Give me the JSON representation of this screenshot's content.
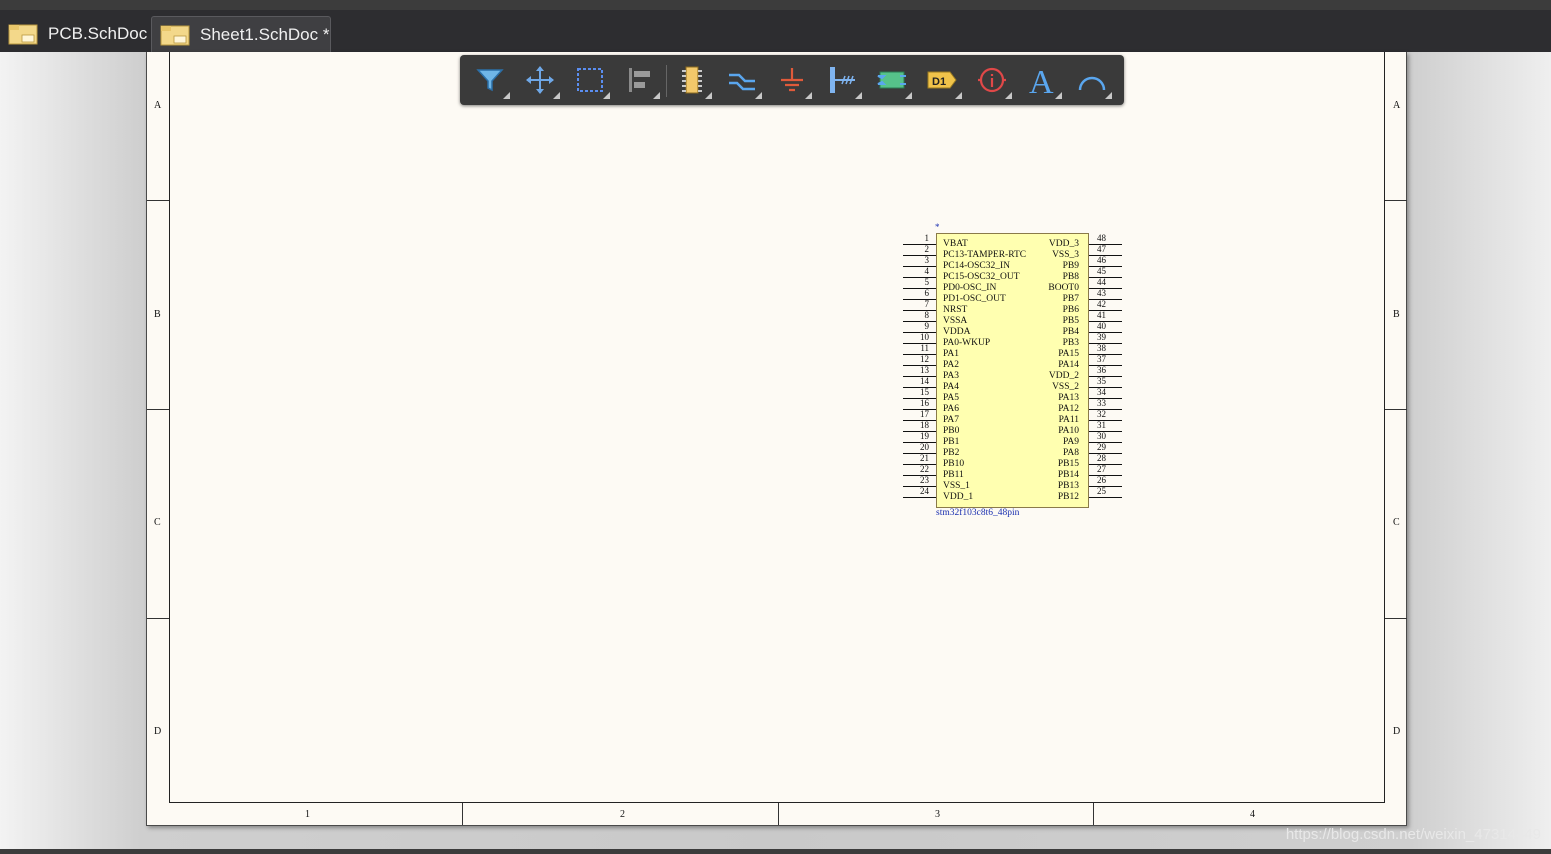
{
  "tabs": [
    {
      "label": "PCB.SchDoc",
      "active": false
    },
    {
      "label": "Sheet1.SchDoc *",
      "active": true
    }
  ],
  "toolbar": {
    "tools": [
      {
        "icon": "filter-icon"
      },
      {
        "icon": "move-icon"
      },
      {
        "icon": "select-rect-icon"
      },
      {
        "icon": "align-icon"
      },
      {
        "icon": "place-component-icon"
      },
      {
        "icon": "wire-icon"
      },
      {
        "icon": "power-port-icon"
      },
      {
        "icon": "harness-icon"
      },
      {
        "icon": "sheet-symbol-icon"
      },
      {
        "icon": "port-icon",
        "text": "D1"
      },
      {
        "icon": "directive-icon"
      },
      {
        "icon": "text-icon",
        "text": "A"
      },
      {
        "icon": "arc-icon"
      }
    ]
  },
  "sheet": {
    "row_letters": [
      "A",
      "B",
      "C",
      "D"
    ],
    "col_numbers": [
      "1",
      "2",
      "3",
      "4"
    ]
  },
  "component": {
    "designator": "*",
    "name": "stm32f103c8t6_48pin",
    "left_pins": [
      {
        "num": "1",
        "name": "VBAT"
      },
      {
        "num": "2",
        "name": "PC13-TAMPER-RTC"
      },
      {
        "num": "3",
        "name": "PC14-OSC32_IN"
      },
      {
        "num": "4",
        "name": "PC15-OSC32_OUT"
      },
      {
        "num": "5",
        "name": "PD0-OSC_IN"
      },
      {
        "num": "6",
        "name": "PD1-OSC_OUT"
      },
      {
        "num": "7",
        "name": "NRST"
      },
      {
        "num": "8",
        "name": "VSSA"
      },
      {
        "num": "9",
        "name": "VDDA"
      },
      {
        "num": "10",
        "name": "PA0-WKUP"
      },
      {
        "num": "11",
        "name": "PA1"
      },
      {
        "num": "12",
        "name": "PA2"
      },
      {
        "num": "13",
        "name": "PA3"
      },
      {
        "num": "14",
        "name": "PA4"
      },
      {
        "num": "15",
        "name": "PA5"
      },
      {
        "num": "16",
        "name": "PA6"
      },
      {
        "num": "17",
        "name": "PA7"
      },
      {
        "num": "18",
        "name": "PB0"
      },
      {
        "num": "19",
        "name": "PB1"
      },
      {
        "num": "20",
        "name": "PB2"
      },
      {
        "num": "21",
        "name": "PB10"
      },
      {
        "num": "22",
        "name": "PB11"
      },
      {
        "num": "23",
        "name": "VSS_1"
      },
      {
        "num": "24",
        "name": "VDD_1"
      }
    ],
    "right_pins": [
      {
        "num": "48",
        "name": "VDD_3"
      },
      {
        "num": "47",
        "name": "VSS_3"
      },
      {
        "num": "46",
        "name": "PB9"
      },
      {
        "num": "45",
        "name": "PB8"
      },
      {
        "num": "44",
        "name": "BOOT0"
      },
      {
        "num": "43",
        "name": "PB7"
      },
      {
        "num": "42",
        "name": "PB6"
      },
      {
        "num": "41",
        "name": "PB5"
      },
      {
        "num": "40",
        "name": "PB4"
      },
      {
        "num": "39",
        "name": "PB3"
      },
      {
        "num": "38",
        "name": "PA15"
      },
      {
        "num": "37",
        "name": "PA14"
      },
      {
        "num": "36",
        "name": "VDD_2"
      },
      {
        "num": "35",
        "name": "VSS_2"
      },
      {
        "num": "34",
        "name": "PA13"
      },
      {
        "num": "33",
        "name": "PA12"
      },
      {
        "num": "32",
        "name": "PA11"
      },
      {
        "num": "31",
        "name": "PA10"
      },
      {
        "num": "30",
        "name": "PA9"
      },
      {
        "num": "29",
        "name": "PA8"
      },
      {
        "num": "28",
        "name": "PB15"
      },
      {
        "num": "27",
        "name": "PB14"
      },
      {
        "num": "26",
        "name": "PB13"
      },
      {
        "num": "25",
        "name": "PB12"
      }
    ]
  },
  "watermark": "https://blog.csdn.net/weixin_47314449"
}
